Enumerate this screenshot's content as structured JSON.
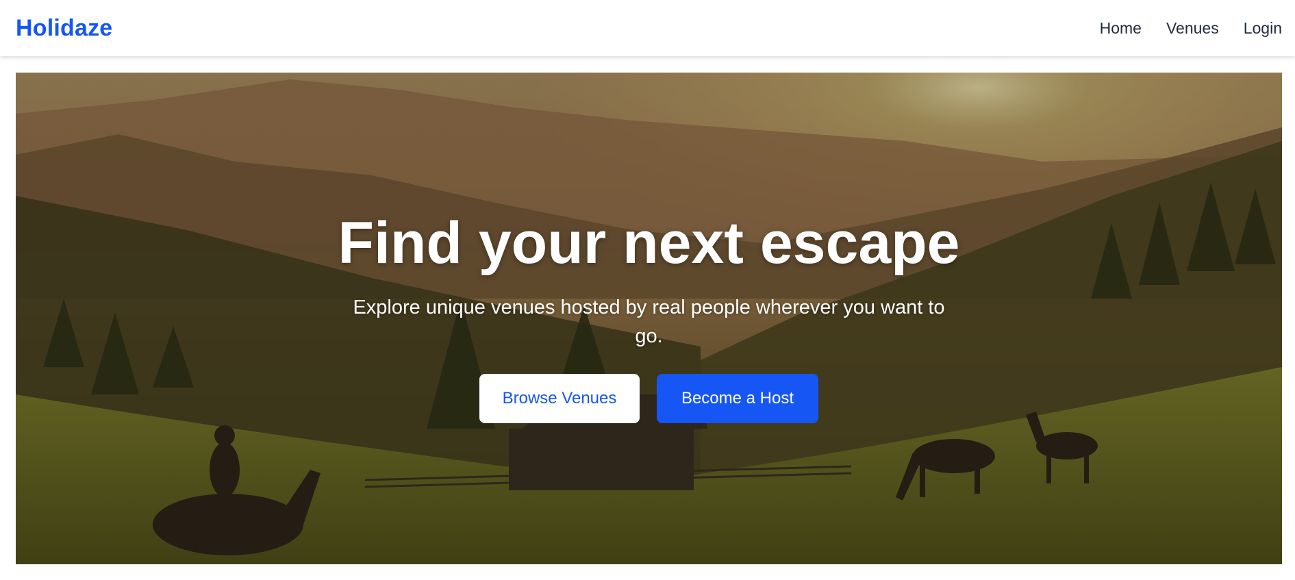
{
  "navbar": {
    "brand": "Holidaze",
    "links": [
      {
        "label": "Home"
      },
      {
        "label": "Venues"
      },
      {
        "label": "Login"
      }
    ]
  },
  "hero": {
    "title": "Find your next escape",
    "subtitle": "Explore unique venues hosted by real people wherever you want to go.",
    "buttons": {
      "browse": "Browse Venues",
      "host": "Become a Host"
    },
    "image": "mountain-valley-sunset-horses-cabin"
  },
  "colors": {
    "brand": "#1656f5",
    "nav_text": "#1f2a3b",
    "white": "#ffffff"
  }
}
